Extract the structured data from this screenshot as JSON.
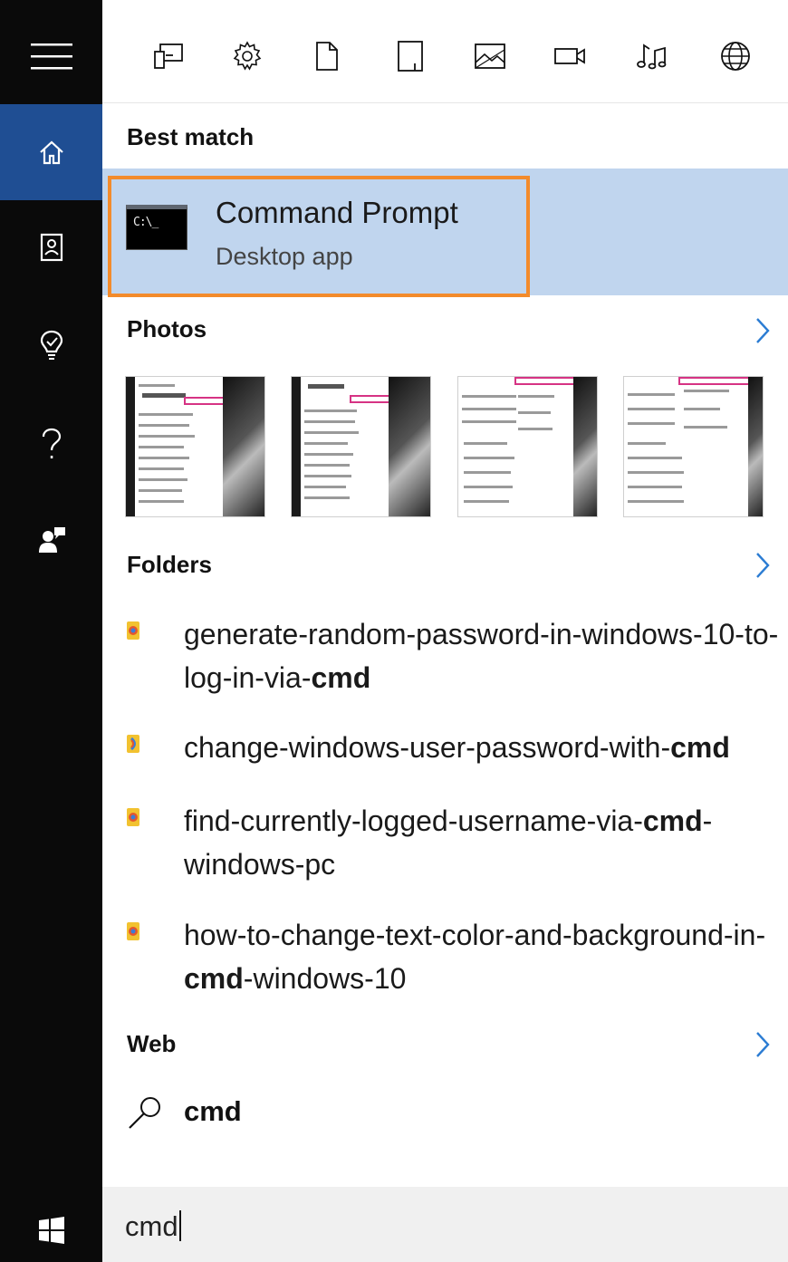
{
  "rail": {
    "items": [
      {
        "name": "hamburger-menu-icon"
      },
      {
        "name": "home-icon",
        "active": true
      },
      {
        "name": "notebook-icon"
      },
      {
        "name": "lightbulb-icon"
      },
      {
        "name": "help-icon"
      },
      {
        "name": "feedback-icon"
      },
      {
        "name": "windows-start-icon"
      }
    ]
  },
  "filters": [
    {
      "name": "apps-filter-icon"
    },
    {
      "name": "settings-filter-icon"
    },
    {
      "name": "documents-filter-icon"
    },
    {
      "name": "folders-filter-icon"
    },
    {
      "name": "photos-filter-icon"
    },
    {
      "name": "videos-filter-icon"
    },
    {
      "name": "music-filter-icon"
    },
    {
      "name": "web-filter-icon"
    }
  ],
  "best_match": {
    "section_label": "Best match",
    "title": "Command Prompt",
    "subtitle": "Desktop app",
    "icon_text": "C:\\_",
    "highlight_color": "#c0d5ee",
    "outline_color": "#f38b2b"
  },
  "photos": {
    "section_label": "Photos",
    "thumbnails": [
      "photo-thumbnail-1",
      "photo-thumbnail-2",
      "photo-thumbnail-3",
      "photo-thumbnail-4"
    ]
  },
  "folders": {
    "section_label": "Folders",
    "items": [
      {
        "before": "generate-random-password-in-windows-10-to-log-in-via-",
        "match": "cmd",
        "after": ""
      },
      {
        "before": "change-windows-user-password-with-",
        "match": "cmd",
        "after": ""
      },
      {
        "before": "find-currently-logged-username-via-",
        "match": "cmd",
        "after": "-windows-pc"
      },
      {
        "before": "how-to-change-text-color-and-background-in-",
        "match": "cmd",
        "after": "-windows-10"
      }
    ]
  },
  "web": {
    "section_label": "Web",
    "query": "cmd"
  },
  "search": {
    "value": "cmd"
  },
  "colors": {
    "rail_bg": "#0a0a0a",
    "rail_active": "#1f4e93",
    "chevron": "#2b7cd3"
  }
}
